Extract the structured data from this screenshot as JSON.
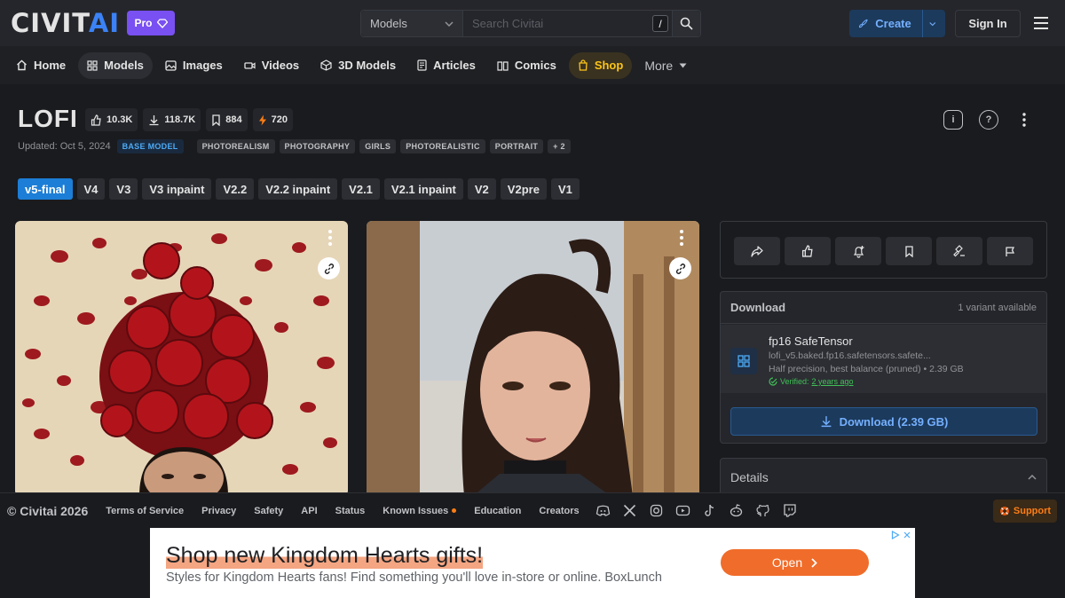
{
  "header": {
    "logo": "CIVIT",
    "logo_ai": "AI",
    "pro_label": "Pro",
    "search_scope": "Models",
    "search_placeholder": "Search Civitai",
    "search_shortcut": "/",
    "create_label": "Create",
    "signin_label": "Sign In"
  },
  "nav": [
    {
      "label": "Home",
      "icon": "home-icon"
    },
    {
      "label": "Models",
      "icon": "grid-icon",
      "active": true
    },
    {
      "label": "Images",
      "icon": "image-icon"
    },
    {
      "label": "Videos",
      "icon": "video-icon"
    },
    {
      "label": "3D Models",
      "icon": "cube-icon"
    },
    {
      "label": "Articles",
      "icon": "article-icon"
    },
    {
      "label": "Comics",
      "icon": "book-icon"
    },
    {
      "label": "Shop",
      "icon": "bag-icon"
    },
    {
      "label": "More",
      "icon": "caret-down-icon"
    }
  ],
  "model": {
    "title": "LOFI",
    "stats": [
      {
        "icon": "thumb-up-icon",
        "value": "10.3K"
      },
      {
        "icon": "download-icon",
        "value": "118.7K"
      },
      {
        "icon": "bookmark-icon",
        "value": "884"
      },
      {
        "icon": "bolt-icon",
        "value": "720"
      }
    ],
    "updated": "Updated: Oct 5, 2024",
    "base_tag": "BASE MODEL",
    "tags": [
      "PHOTOREALISM",
      "PHOTOGRAPHY",
      "GIRLS",
      "PHOTOREALISTIC",
      "PORTRAIT",
      "+ 2"
    ],
    "versions": [
      "v5-final",
      "V4",
      "V3",
      "V3 inpaint",
      "V2.2",
      "V2.2 inpaint",
      "V2.1",
      "V2.1 inpaint",
      "V2",
      "V2pre",
      "V1"
    ],
    "active_version": "v5-final"
  },
  "download": {
    "title": "Download",
    "variants": "1 variant available",
    "file_name": "fp16 SafeTensor",
    "file_path": "lofi_v5.baked.fp16.safetensors.safete...",
    "file_desc": "Half precision, best balance (pruned) • 2.39 GB",
    "verified_prefix": "Verified:",
    "verified_when": "2 years ago",
    "button": "Download (2.39 GB)"
  },
  "details_label": "Details",
  "footer": {
    "copyright": "© Civitai 2026",
    "links": [
      "Terms of Service",
      "Privacy",
      "Safety",
      "API",
      "Status",
      "Known Issues",
      "Education",
      "Creators"
    ],
    "social": [
      "discord-icon",
      "x-icon",
      "instagram-icon",
      "youtube-icon",
      "tiktok-icon",
      "reddit-icon",
      "github-icon",
      "twitch-icon"
    ],
    "support": "Support"
  },
  "ad": {
    "headline": "Shop new Kingdom Hearts gifts!",
    "sub": "Styles for Kingdom Hearts fans! Find something you'll love in-store or online. BoxLunch",
    "cta": "Open"
  },
  "colors": {
    "accent": "#1c7ed6",
    "pro": "#7950f2",
    "shop": "#fcc419",
    "support": "#fd7e14"
  }
}
